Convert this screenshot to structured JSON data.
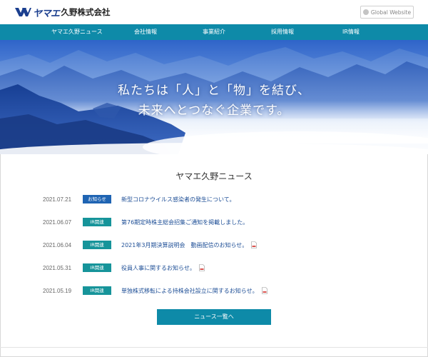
{
  "header": {
    "logo_kana": "ヤマエ",
    "logo_name": "久野株式会社",
    "global_label": "Global Website"
  },
  "nav": {
    "items": [
      {
        "label": "ヤマエ久野ニュース"
      },
      {
        "label": "会社情報"
      },
      {
        "label": "事業紹介"
      },
      {
        "label": "採用情報"
      },
      {
        "label": "IR情報"
      }
    ]
  },
  "hero": {
    "line1": "私たちは「人」と「物」を結び、",
    "line2": "未来へとつなぐ企業です。"
  },
  "news": {
    "title": "ヤマエ久野ニュース",
    "items": [
      {
        "date": "2021.07.21",
        "badge": "お知らせ",
        "text": "新型コロナウイルス感染者の発生について。"
      },
      {
        "date": "2021.06.07",
        "badge": "IR関連",
        "text": "第76期定時株主総会招集ご通知を掲載しました。"
      },
      {
        "date": "2021.06.04",
        "badge": "IR関連",
        "text": "2021年3月期決算説明会　動画配信のお知らせ。"
      },
      {
        "date": "2021.05.31",
        "badge": "IR関連",
        "text": "役員人事に関するお知らせ。"
      },
      {
        "date": "2021.05.19",
        "badge": "IR関連",
        "text": "単独株式移転による持株会社設立に関するお知らせ。"
      }
    ],
    "more_label": "ニュース一覧へ"
  },
  "colors": {
    "nav": "#0e8aa8",
    "badge_info": "#1f64b3",
    "badge_ir": "#16949a",
    "link": "#1d4e96",
    "logo": "#1b3f8f"
  }
}
